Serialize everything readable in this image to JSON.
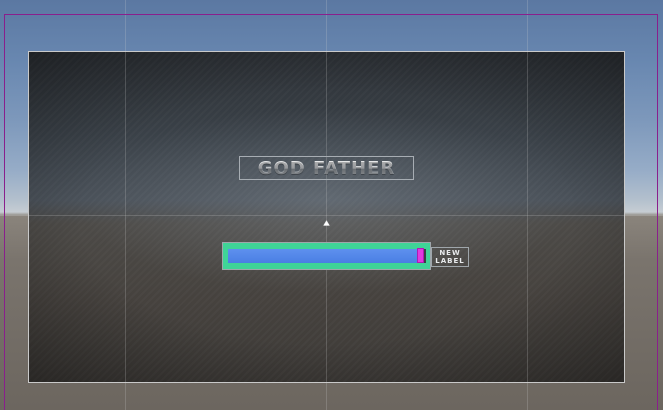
{
  "title": {
    "text": "GOD FATHER"
  },
  "progress_bar": {
    "value_percent": 97,
    "track_color": "#4a7fe4",
    "frame_color": "#3fd497",
    "handle_color": "#e13adf"
  },
  "label": {
    "line1": "NEW",
    "line2": "LABEL"
  },
  "icons": {
    "pivot": "rect-transform-pivot-icon"
  },
  "colors": {
    "canvas_outline": "#8a1f8c",
    "panel_border": "#c9c9c9",
    "sky_top": "#5b78a2",
    "ground": "#7a746d"
  }
}
